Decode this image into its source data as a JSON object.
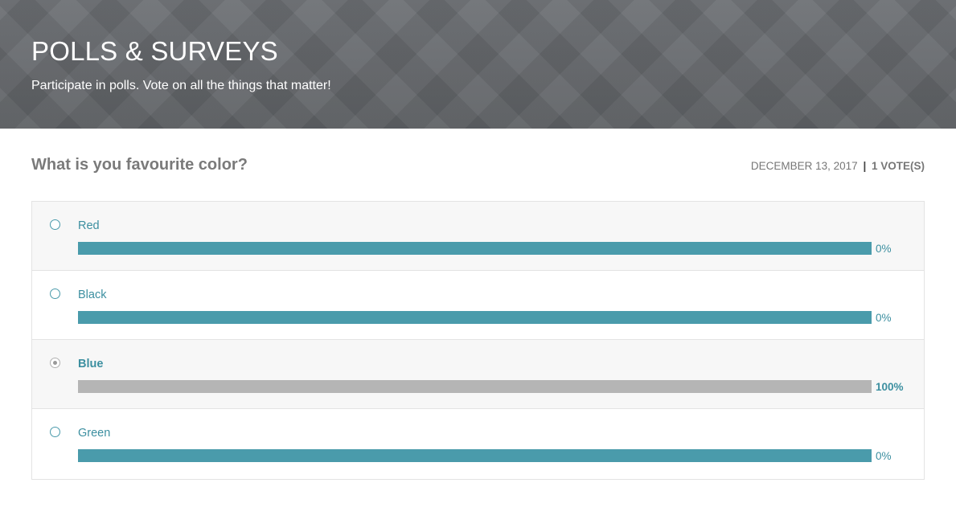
{
  "header": {
    "title": "POLLS & SURVEYS",
    "subtitle": "Participate in polls. Vote on all the things that matter!"
  },
  "poll": {
    "question": "What is you favourite color?",
    "date": "DECEMBER 13, 2017",
    "separator": "|",
    "votes": "1 VOTE(S)",
    "options": [
      {
        "label": "Red",
        "percent_text": "0%",
        "percent": 0,
        "selected": false
      },
      {
        "label": "Black",
        "percent_text": "0%",
        "percent": 0,
        "selected": false
      },
      {
        "label": "Blue",
        "percent_text": "100%",
        "percent": 100,
        "selected": true
      },
      {
        "label": "Green",
        "percent_text": "0%",
        "percent": 0,
        "selected": false
      }
    ]
  },
  "colors": {
    "accent": "#4a9bab",
    "selected_bar": "#b5b5b5",
    "header_bg": "#64676b"
  }
}
